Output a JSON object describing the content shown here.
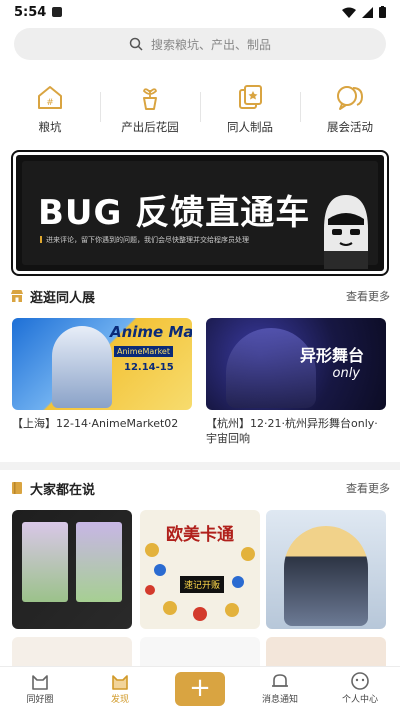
{
  "status_bar": {
    "time": "5:54"
  },
  "search": {
    "placeholder": "搜索粮坑、产出、制品"
  },
  "categories": [
    {
      "label": "粮坑",
      "icon": "house-icon"
    },
    {
      "label": "产出后花园",
      "icon": "plant-pot-icon"
    },
    {
      "label": "同人制品",
      "icon": "cards-icon"
    },
    {
      "label": "展会活动",
      "icon": "chat-bubbles-icon"
    }
  ],
  "banner": {
    "title": "BUG 反馈直通车",
    "subtitle": "进来评论，留下你遇到的问题，我们会尽快整理并交给程序员处理"
  },
  "expo_section": {
    "title": "逛逛同人展",
    "more": "查看更多",
    "cards": [
      {
        "caption": "【上海】12-14·AnimeMarket02",
        "art_title": "Anime Market",
        "art_sub": "AnimeMarket",
        "art_date": "12.14-15"
      },
      {
        "caption": "【杭州】12·21·杭州异形舞台only·宇宙回响",
        "art_title": "异形舞台",
        "art_sub": "only"
      }
    ]
  },
  "talk_section": {
    "title": "大家都在说",
    "more": "查看更多",
    "cards": [
      {
        "art_title": ""
      },
      {
        "art_title": "欧美卡通",
        "art_badge": "速记开贩"
      },
      {
        "art_title": ""
      }
    ]
  },
  "bottom_nav": [
    {
      "label": "同好圈",
      "icon": "cat-icon",
      "active": false
    },
    {
      "label": "发现",
      "icon": "discover-cat-icon",
      "active": true
    },
    {
      "label": "+",
      "icon": "add-icon",
      "active": false
    },
    {
      "label": "消息通知",
      "icon": "bell-icon",
      "active": false
    },
    {
      "label": "个人中心",
      "icon": "profile-icon",
      "active": false
    }
  ],
  "colors": {
    "accent": "#d9a441",
    "banner_bg": "#1b1b1b"
  }
}
